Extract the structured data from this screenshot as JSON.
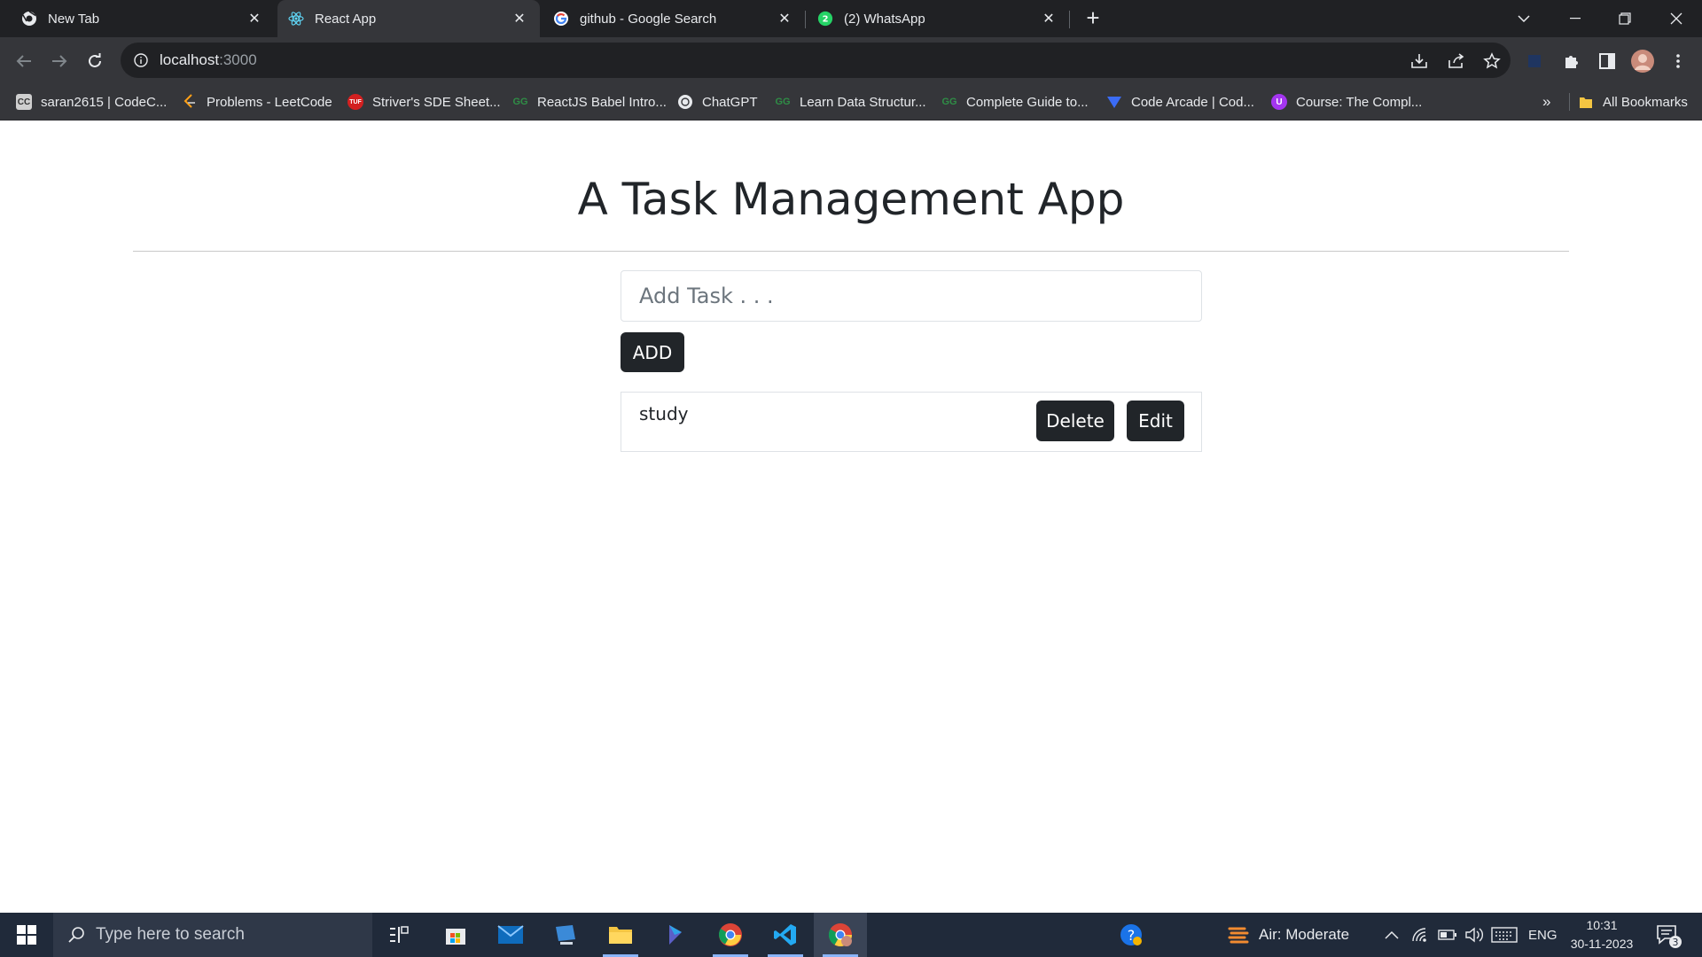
{
  "browser": {
    "tabs": [
      {
        "label": "New Tab",
        "icon": "chrome-icon"
      },
      {
        "label": "React App",
        "icon": "react-icon",
        "active": true
      },
      {
        "label": "github - Google Search",
        "icon": "google-icon"
      },
      {
        "label": "(2) WhatsApp",
        "icon": "whatsapp-icon",
        "badge": "2"
      }
    ],
    "address": {
      "host": "localhost",
      "port": ":3000"
    },
    "bookmarks": [
      {
        "label": "saran2615 | CodeC...",
        "icon": "CC"
      },
      {
        "label": "Problems - LeetCode",
        "icon": "leetcode-icon"
      },
      {
        "label": "Striver's SDE Sheet...",
        "icon": "TUF"
      },
      {
        "label": "ReactJS Babel Intro...",
        "icon": "gfg-icon"
      },
      {
        "label": "ChatGPT",
        "icon": "chatgpt-icon"
      },
      {
        "label": "Learn Data Structur...",
        "icon": "gfg-icon"
      },
      {
        "label": "Complete Guide to...",
        "icon": "gfg-icon"
      },
      {
        "label": "Code Arcade | Cod...",
        "icon": "code-arcade-icon"
      },
      {
        "label": "Course: The Compl...",
        "icon": "udemy-icon"
      }
    ],
    "overflow": "»",
    "all_bookmarks": "All Bookmarks"
  },
  "app": {
    "title": "A Task Management App",
    "input_placeholder": "Add Task . . .",
    "add_label": "ADD",
    "tasks": [
      {
        "text": "study",
        "delete_label": "Delete",
        "edit_label": "Edit"
      }
    ]
  },
  "taskbar": {
    "search_placeholder": "Type here to search",
    "weather": "Air: Moderate",
    "language": "ENG",
    "time": "10:31",
    "date": "30-11-2023",
    "notification_count": "3"
  },
  "colors": {
    "tab_strip": "#202124",
    "toolbar": "#35363a",
    "button_dark": "#212529",
    "taskbar": "#202a3a"
  }
}
